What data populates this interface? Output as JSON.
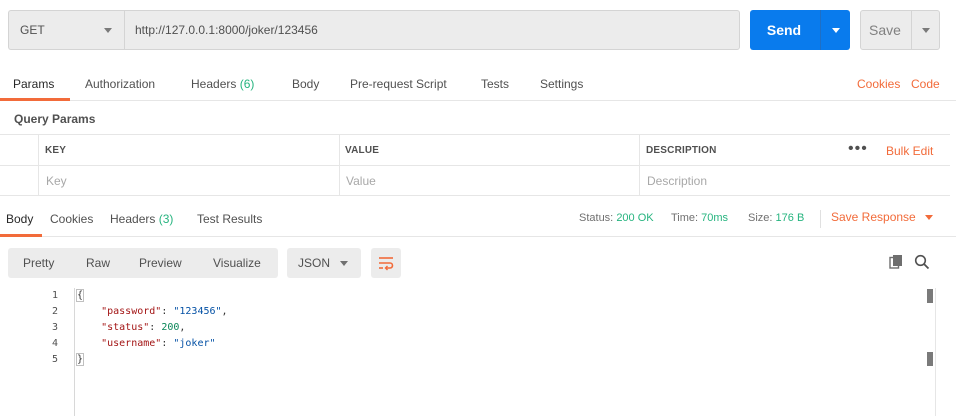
{
  "request": {
    "method": "GET",
    "url": "http://127.0.0.1:8000/joker/123456",
    "send_label": "Send",
    "save_label": "Save"
  },
  "request_tabs": {
    "params": "Params",
    "authorization": "Authorization",
    "headers": "Headers",
    "headers_count": "(6)",
    "body": "Body",
    "pre_request_script": "Pre-request Script",
    "tests": "Tests",
    "settings": "Settings",
    "cookies": "Cookies",
    "code": "Code"
  },
  "query_params": {
    "title": "Query Params",
    "columns": {
      "key": "KEY",
      "value": "VALUE",
      "description": "DESCRIPTION"
    },
    "placeholders": {
      "key": "Key",
      "value": "Value",
      "description": "Description"
    },
    "more": "•••",
    "bulk_edit": "Bulk Edit"
  },
  "response_tabs": {
    "body": "Body",
    "cookies": "Cookies",
    "headers": "Headers",
    "headers_count": "(3)",
    "test_results": "Test Results"
  },
  "response_status": {
    "status_label": "Status:",
    "status_value": "200 OK",
    "time_label": "Time:",
    "time_value": "70ms",
    "size_label": "Size:",
    "size_value": "176 B",
    "save_response": "Save Response"
  },
  "response_view": {
    "tabs": [
      "Pretty",
      "Raw",
      "Preview",
      "Visualize"
    ],
    "format": "JSON"
  },
  "response_body": {
    "line_numbers": [
      "1",
      "2",
      "3",
      "4",
      "5"
    ],
    "open_brace": "{",
    "close_brace": "}",
    "fields": [
      {
        "key": "\"password\"",
        "sep": ": ",
        "value": "\"123456\"",
        "tail": ",",
        "type": "string"
      },
      {
        "key": "\"status\"",
        "sep": ": ",
        "value": "200",
        "tail": ",",
        "type": "number"
      },
      {
        "key": "\"username\"",
        "sep": ": ",
        "value": "\"joker\"",
        "tail": "",
        "type": "string"
      }
    ]
  },
  "colors": {
    "accent_orange": "#f26b3a",
    "send_blue": "#097bed",
    "success_green": "#26b47f"
  }
}
